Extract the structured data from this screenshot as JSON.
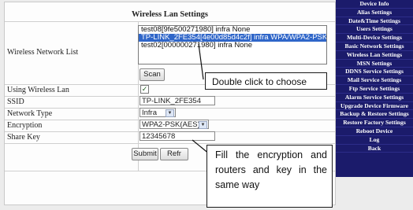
{
  "panel": {
    "title": "Wireless Lan Settings",
    "labels": {
      "network_list": "Wireless Network List",
      "using_wireless": "Using Wireless Lan",
      "ssid": "SSID",
      "network_type": "Network Type",
      "encryption": "Encryption",
      "share_key": "Share Key"
    },
    "networks": [
      {
        "text": "test08[9fe500271980] infra None",
        "selected": false
      },
      {
        "text": "TP-LINK_2FE354[4e00d85d4c2f] infra WPA/WPA2-PSK",
        "selected": true
      },
      {
        "text": "test02[000000271980] infra None",
        "selected": false
      }
    ],
    "scan_label": "Scan",
    "using_wireless_checked": "✓",
    "ssid_value": "TP-LINK_2FE354",
    "network_type_value": "Infra",
    "encryption_value": "WPA2-PSK(AES)",
    "share_key_value": "12345678",
    "submit_label": "Submit",
    "refresh_label": "Refr"
  },
  "menu": {
    "items": [
      "Device Info",
      "Alias Settings",
      "Date&Time Settings",
      "Users Settings",
      "Multi-Device Settings",
      "Basic Network Settings",
      "Wireless Lan Settings",
      "MSN Settings",
      "DDNS Service Settings",
      "Mail Service Settings",
      "Ftp Service Settings",
      "Alarm Service Settings",
      "Upgrade Device Firmware",
      "Backup & Restore Settings",
      "Restore Factory Settings",
      "Reboot Device",
      "Log",
      "Back"
    ],
    "bg_color": "#1b1b6b"
  },
  "callouts": {
    "choose": "Double click to choose",
    "fill": "Fill the encryption and routers and key in the same way"
  }
}
